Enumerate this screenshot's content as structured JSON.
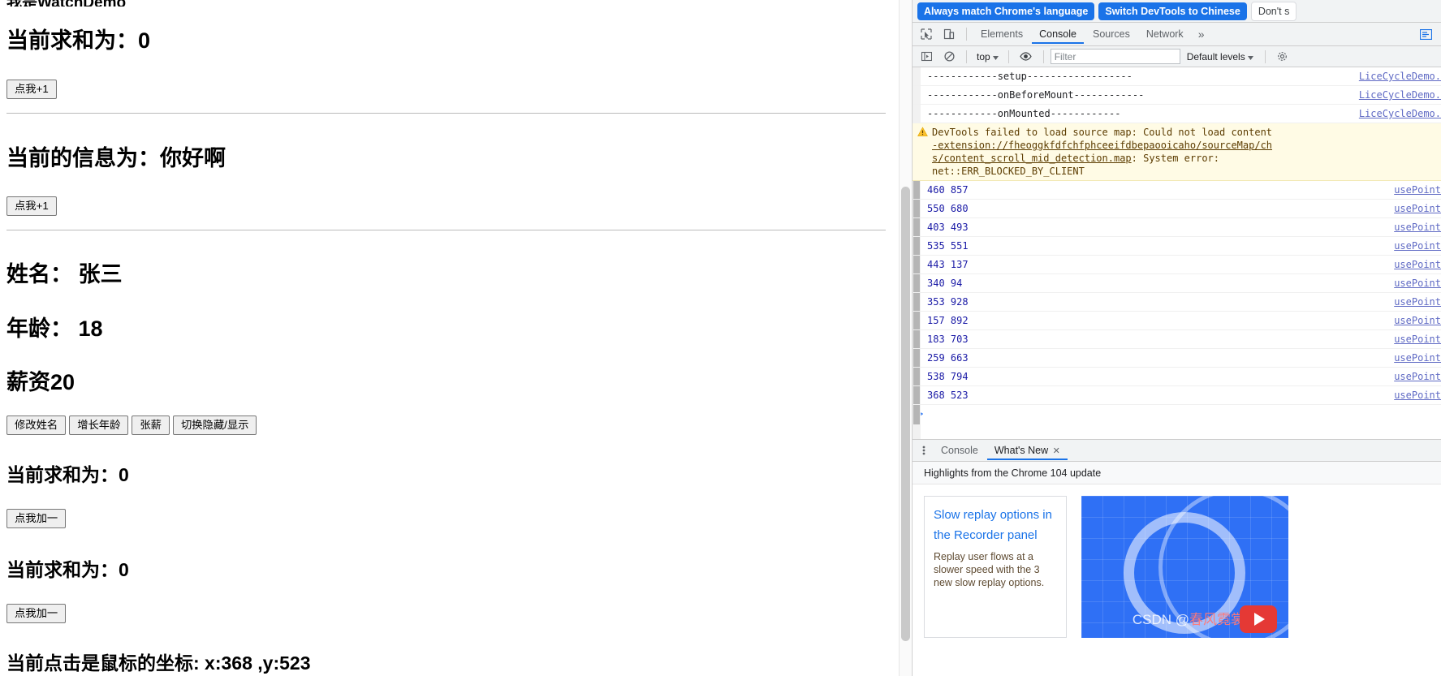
{
  "page": {
    "top_cut_title": "我是WatchDemo",
    "sections": [
      {
        "heading": "当前求和为：0",
        "button": "点我+1"
      },
      {
        "heading": "当前的信息为：你好啊",
        "button": "点我+1"
      }
    ],
    "person": {
      "name_label": "姓名： 张三",
      "age_label": "年龄： 18",
      "salary_label": "薪资20",
      "buttons": [
        "修改姓名",
        "增长年龄",
        "张薪",
        "切换隐藏/显示"
      ]
    },
    "sum_sections": [
      {
        "heading": "当前求和为：0",
        "button": "点我加一"
      },
      {
        "heading": "当前求和为：0",
        "button": "点我加一"
      }
    ],
    "mouse_line": "当前点击是鼠标的坐标: x:368 ,y:523"
  },
  "devtools": {
    "language_bar": {
      "primary": "Always match Chrome's language",
      "secondary": "Switch DevTools to Chinese",
      "dismiss": "Don't s"
    },
    "tabs": [
      {
        "label": "Elements",
        "active": false
      },
      {
        "label": "Console",
        "active": true
      },
      {
        "label": "Sources",
        "active": false
      },
      {
        "label": "Network",
        "active": false
      }
    ],
    "more_tabs": "»",
    "console_toolbar": {
      "context": "top",
      "filter_placeholder": "Filter",
      "levels": "Default levels"
    },
    "messages": [
      {
        "type": "log",
        "text": "------------setup------------------",
        "source": "LiceCycleDemo."
      },
      {
        "type": "log",
        "text": "------------onBeforeMount------------",
        "source": "LiceCycleDemo."
      },
      {
        "type": "log",
        "text": "------------onMounted------------",
        "source": "LiceCycleDemo."
      },
      {
        "type": "warning",
        "line1": "DevTools failed to load source map: Could not load content",
        "line2": "-extension://fheoggkfdfchfphceeifdbepaooicaho/sourceMap/ch",
        "line3": "s/content_scroll_mid_detection.map",
        "line3_tail": ": System error:",
        "line4": "net::ERR_BLOCKED_BY_CLIENT"
      },
      {
        "type": "num",
        "text": "460 857",
        "source": "usePoint"
      },
      {
        "type": "num",
        "text": "550 680",
        "source": "usePoint"
      },
      {
        "type": "num",
        "text": "403 493",
        "source": "usePoint"
      },
      {
        "type": "num",
        "text": "535 551",
        "source": "usePoint"
      },
      {
        "type": "num",
        "text": "443 137",
        "source": "usePoint"
      },
      {
        "type": "num",
        "text": "340 94",
        "source": "usePoint"
      },
      {
        "type": "num",
        "text": "353 928",
        "source": "usePoint"
      },
      {
        "type": "num",
        "text": "157 892",
        "source": "usePoint"
      },
      {
        "type": "num",
        "text": "183 703",
        "source": "usePoint"
      },
      {
        "type": "num",
        "text": "259 663",
        "source": "usePoint"
      },
      {
        "type": "num",
        "text": "538 794",
        "source": "usePoint"
      },
      {
        "type": "num",
        "text": "368 523",
        "source": "usePoint"
      }
    ],
    "prompt": ">",
    "drawer": {
      "tabs": [
        {
          "label": "Console",
          "active": false,
          "closable": false
        },
        {
          "label": "What's New",
          "active": true,
          "closable": true
        }
      ],
      "close_glyph": "✕",
      "subtitle": "Highlights from the Chrome 104 update",
      "card": {
        "title_line1": "Slow replay options in",
        "title_line2": "the Recorder panel",
        "body": "Replay user flows at a slower speed with the 3 new slow replay options."
      },
      "watermark_prefix": "CSDN @",
      "watermark_cn": "春风霓裳"
    }
  },
  "colors": {
    "accent": "#1a73e8",
    "warning_bg": "#fffbe5",
    "warning_text": "#5c3c00",
    "console_number": "#1a1aa6",
    "source_link": "#5f6ac4"
  }
}
